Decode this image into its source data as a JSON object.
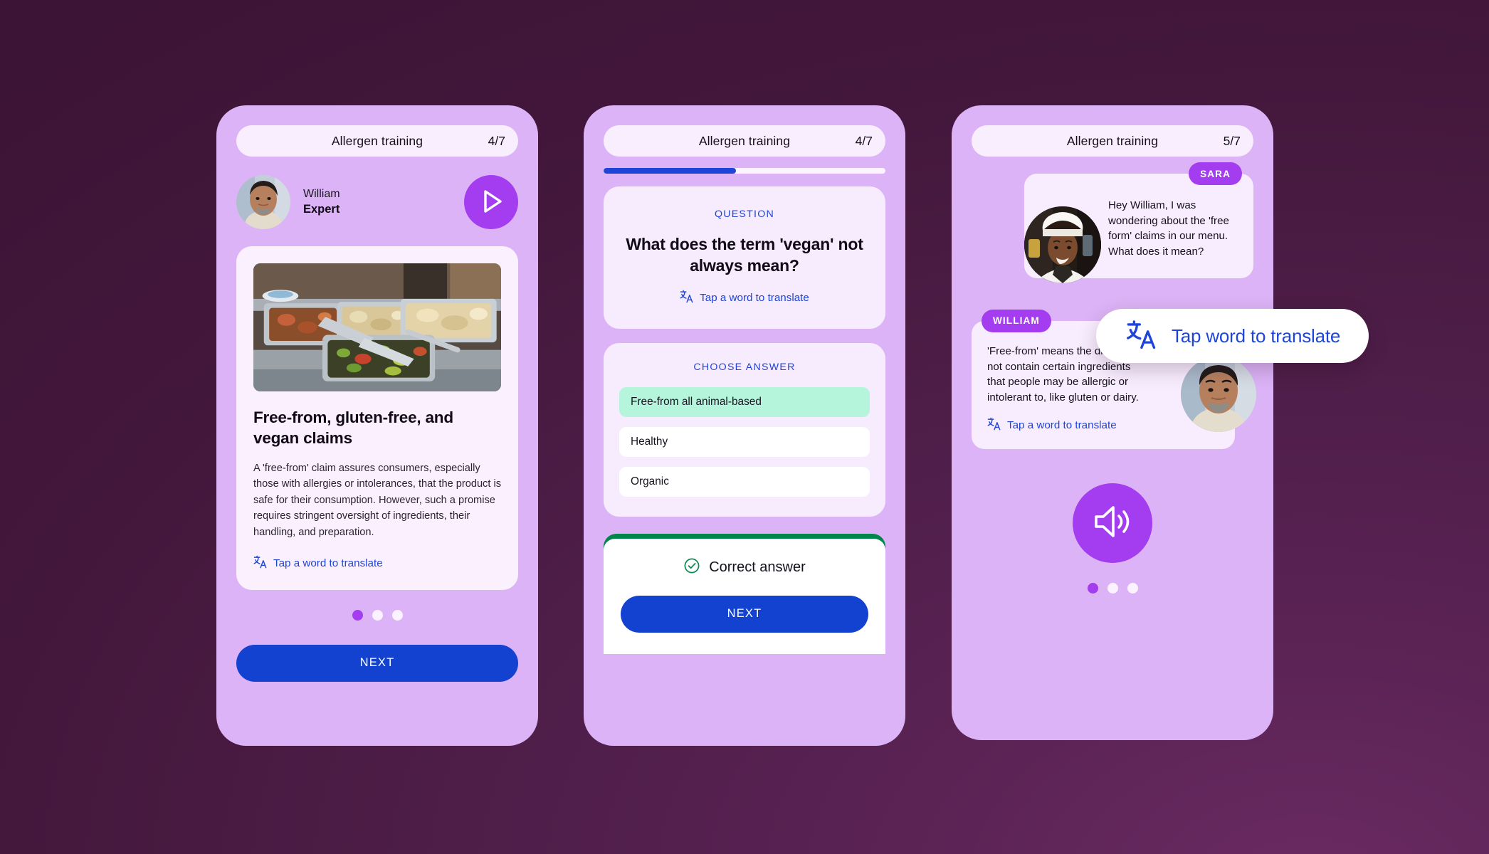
{
  "theme": {
    "background_dark": "#43173C",
    "phone_body": "#DCB3F6",
    "accent_purple": "#A43CEF",
    "accent_blue": "#1342D0",
    "link_blue": "#1F45D8",
    "correct_green": "#00854A",
    "selected_answer": "#B5F5DC",
    "card_surface": "#FAF0FE"
  },
  "phone1": {
    "topbar": {
      "title": "Allergen training",
      "count": "4/7"
    },
    "expert": {
      "name": "William",
      "role": "Expert",
      "avatar_icon": "avatar-photo-william",
      "play_icon": "play-icon"
    },
    "lesson": {
      "photo_icon": "buffet-steam-table-photo",
      "title": "Free-from, gluten-free, and vegan claims",
      "body": "A 'free-from' claim assures consumers, especially those with allergies or intolerances, that the product is safe for their consumption. However, such a promise requires stringent oversight of ingredients, their handling, and preparation.",
      "translate_label": "Tap a word to translate",
      "translate_icon": "translate-icon"
    },
    "dots": {
      "count": 3,
      "active_index": 0
    },
    "next_label": "NEXT"
  },
  "phone2": {
    "topbar": {
      "title": "Allergen training",
      "count": "4/7"
    },
    "progress": {
      "percent": 47
    },
    "question": {
      "kicker": "QUESTION",
      "text": "What does the term 'vegan' not always mean?",
      "translate_label": "Tap a word to translate",
      "translate_icon": "translate-icon"
    },
    "answers": {
      "kicker": "CHOOSE ANSWER",
      "options": [
        {
          "label": "Free-from all animal-based",
          "selected": true
        },
        {
          "label": "Healthy",
          "selected": false
        },
        {
          "label": "Organic",
          "selected": false
        }
      ]
    },
    "feedback": {
      "status_label": "Correct answer",
      "status_icon": "check-circle-icon",
      "next_label": "NEXT"
    }
  },
  "phone3": {
    "topbar": {
      "title": "Allergen training",
      "count": "5/7"
    },
    "messages": [
      {
        "tag": "SARA",
        "avatar_icon": "avatar-photo-sara-chef",
        "text": "Hey William, I was wondering about the 'free  form' claims in our menu. What does it mean?"
      },
      {
        "tag": "WILLIAM",
        "avatar_icon": "avatar-photo-william",
        "text": "'Free-from' means the dish does not contain certain ingredients that people may be allergic or intolerant to, like gluten or dairy.",
        "translate_label": "Tap a word to translate",
        "translate_icon": "translate-icon"
      }
    ],
    "speaker_icon": "speaker-volume-icon",
    "dots": {
      "count": 3,
      "active_index": 0
    }
  },
  "callout": {
    "label": "Tap word to translate",
    "icon": "translate-icon"
  }
}
